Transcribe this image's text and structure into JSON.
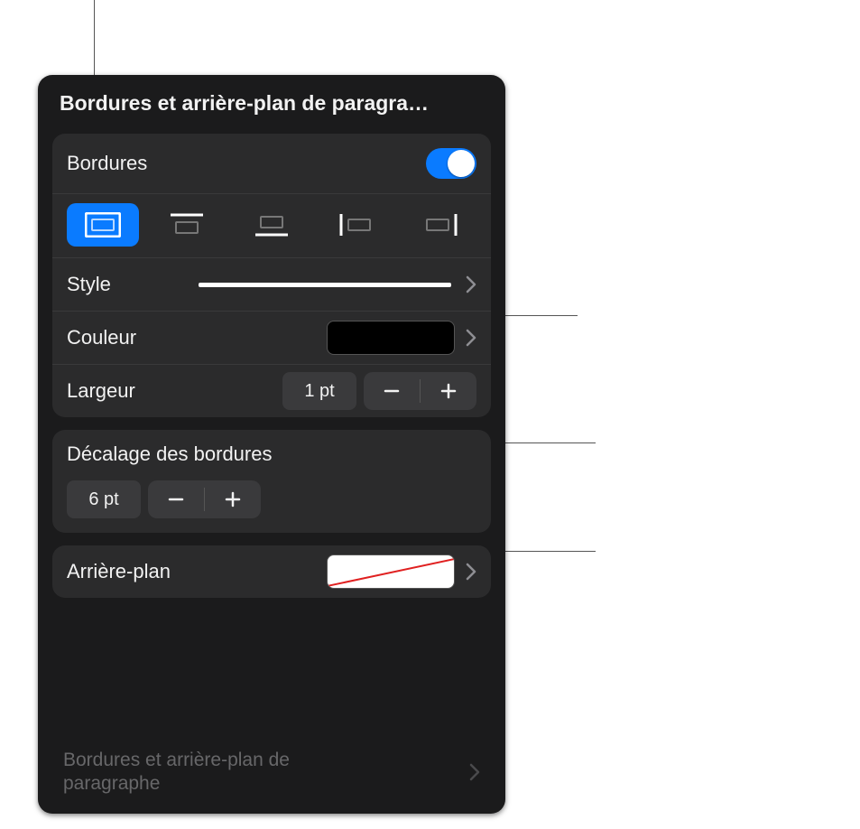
{
  "title": "Bordures et arrière-plan de paragra…",
  "borders": {
    "label": "Bordures",
    "enabled": true,
    "style_label": "Style",
    "color_label": "Couleur",
    "color_value": "#000000",
    "width_label": "Largeur",
    "width_value": "1 pt",
    "offset_label": "Décalage des bordures",
    "offset_value": "6 pt",
    "segments": [
      {
        "name": "border-all",
        "selected": true
      },
      {
        "name": "border-top",
        "selected": false
      },
      {
        "name": "border-bottom",
        "selected": false
      },
      {
        "name": "border-left",
        "selected": false
      },
      {
        "name": "border-right",
        "selected": false
      }
    ]
  },
  "background": {
    "label": "Arrière-plan",
    "fill": "none"
  },
  "behind_item_label": "Bordures et arrière-plan de paragraphe"
}
